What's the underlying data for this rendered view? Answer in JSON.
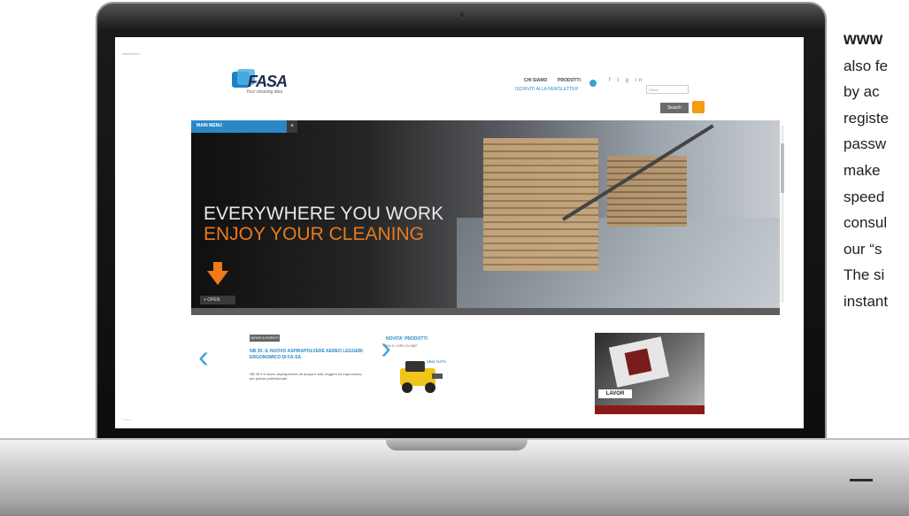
{
  "article": {
    "lines": [
      "www",
      "also fe",
      "by ac",
      "registe",
      "passw",
      "make",
      "speed",
      "consul",
      "our “s",
      "The si",
      "instant"
    ]
  },
  "site": {
    "top_corner_text": "www.fasa.it",
    "logo_text": "FASA",
    "tagline": "Your cleaning idea",
    "nav": {
      "item1": "CHI SIAMO",
      "item2": "PRODOTTI"
    },
    "newsletter_label": "ISCRIVITI ALLA NEWSLETTER",
    "social_icons": "f  t  g  in",
    "search_placeholder": "Cerca",
    "search_button": "Search",
    "hero": {
      "menu_label": "MAIN MENU",
      "menu_toggle": "+",
      "title_line1": "EVERYWHERE YOU WORK",
      "title_line2": "ENJOY YOUR CLEANING",
      "tab_label": "+ OPEN"
    },
    "news": {
      "badge": "NEWS & EVENTI",
      "title": "NB 30: IL NUOVO ASPIRAPOLVERE AEREO LEGGERI ERGONOMICO DI FA-SA",
      "body": "NB 30 è il nuovo aspirapolvere ad acqua e aria, leggero ed ergonomico, per pulizie professionali."
    },
    "promo": {
      "title": "NOVITA' PRODOTTI",
      "subtitle": "FAI IL GIRO DI 360°",
      "link": "VEDI TUTTI"
    },
    "ad": {
      "logo": "LAVOR"
    },
    "footer_text": "© fasa.it",
    "arrow_left": "‹",
    "arrow_right": "›"
  },
  "colors": {
    "brand_blue": "#2a88c8",
    "accent_orange": "#e87a1f"
  }
}
